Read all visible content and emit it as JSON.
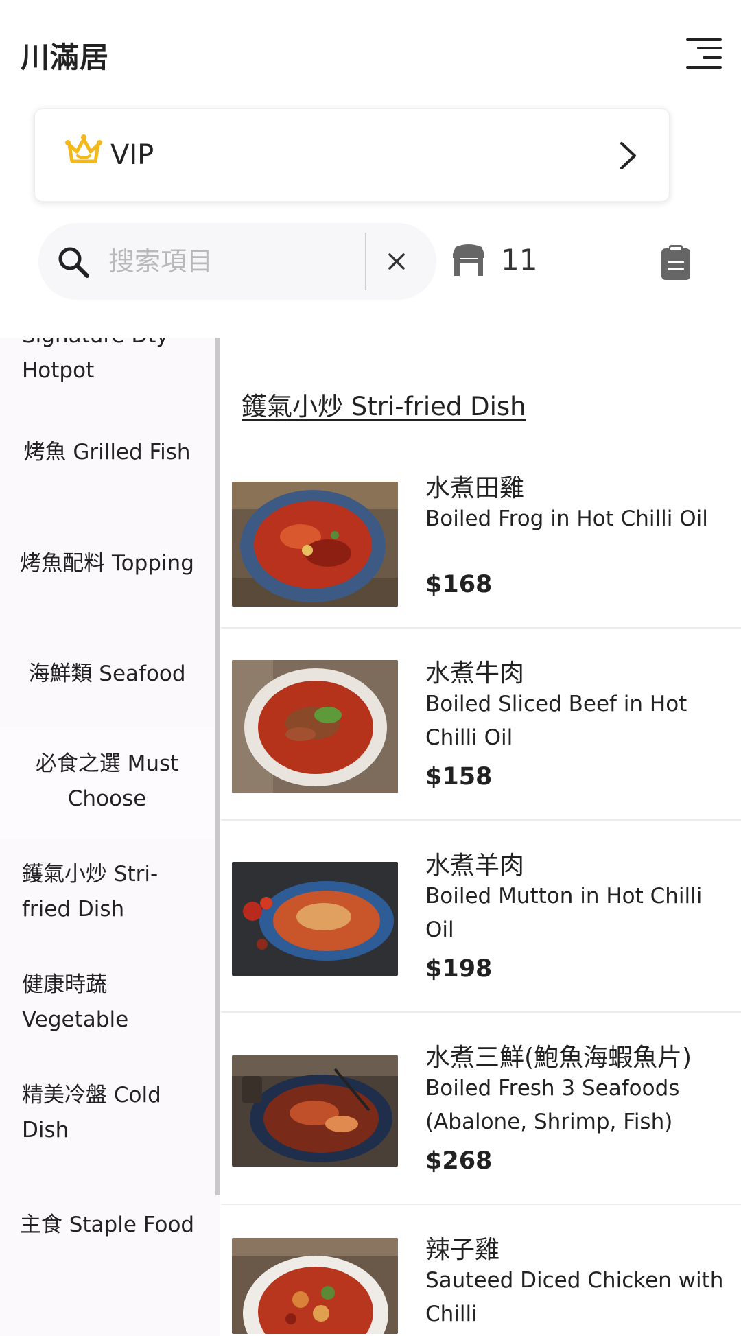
{
  "app": {
    "title": "川滿居"
  },
  "vip": {
    "label": "VIP"
  },
  "search": {
    "placeholder": "搜索項目",
    "value": ""
  },
  "table": {
    "number": "11"
  },
  "sidebar": {
    "items": [
      {
        "label": "Signature Dty Hotpot"
      },
      {
        "label": "烤魚 Grilled Fish"
      },
      {
        "label": "烤魚配料 Topping"
      },
      {
        "label": "海鮮類 Seafood"
      },
      {
        "label": "必食之選 Must Choose",
        "active": true
      },
      {
        "label": "鑊氣小炒 Stri-fried Dish"
      },
      {
        "label": "健康時蔬 Vegetable"
      },
      {
        "label": "精美冷盤 Cold Dish"
      },
      {
        "label": "主食 Staple Food"
      }
    ]
  },
  "section": {
    "title": "鑊氣小炒 Stri-fried Dish"
  },
  "dishes": [
    {
      "name_cn": "水煮田雞",
      "name_en": "Boiled Frog in Hot Chilli Oil",
      "price": "$168"
    },
    {
      "name_cn": "水煮牛肉",
      "name_en": "Boiled Sliced Beef in Hot Chilli Oil",
      "price": "$158"
    },
    {
      "name_cn": "水煮羊肉",
      "name_en": "Boiled Mutton in Hot Chilli Oil",
      "price": "$198"
    },
    {
      "name_cn": "水煮三鮮(鮑魚海蝦魚片)",
      "name_en": "Boiled Fresh 3 Seafoods (Abalone, Shrimp, Fish)",
      "price": "$268"
    },
    {
      "name_cn": "辣子雞",
      "name_en": "Sauteed Diced Chicken with Chilli",
      "price": ""
    }
  ],
  "colors": {
    "accent": "#ee4b2b",
    "vip_gold": "#f2b81c",
    "sidebar_bg": "#fbf9fc"
  },
  "icons": {
    "menu": "hamburger-menu-icon",
    "vip": "crown-icon",
    "arrow": "chevron-right-icon",
    "search": "search-icon",
    "clear": "close-icon",
    "table": "table-icon",
    "order": "clipboard-icon"
  }
}
